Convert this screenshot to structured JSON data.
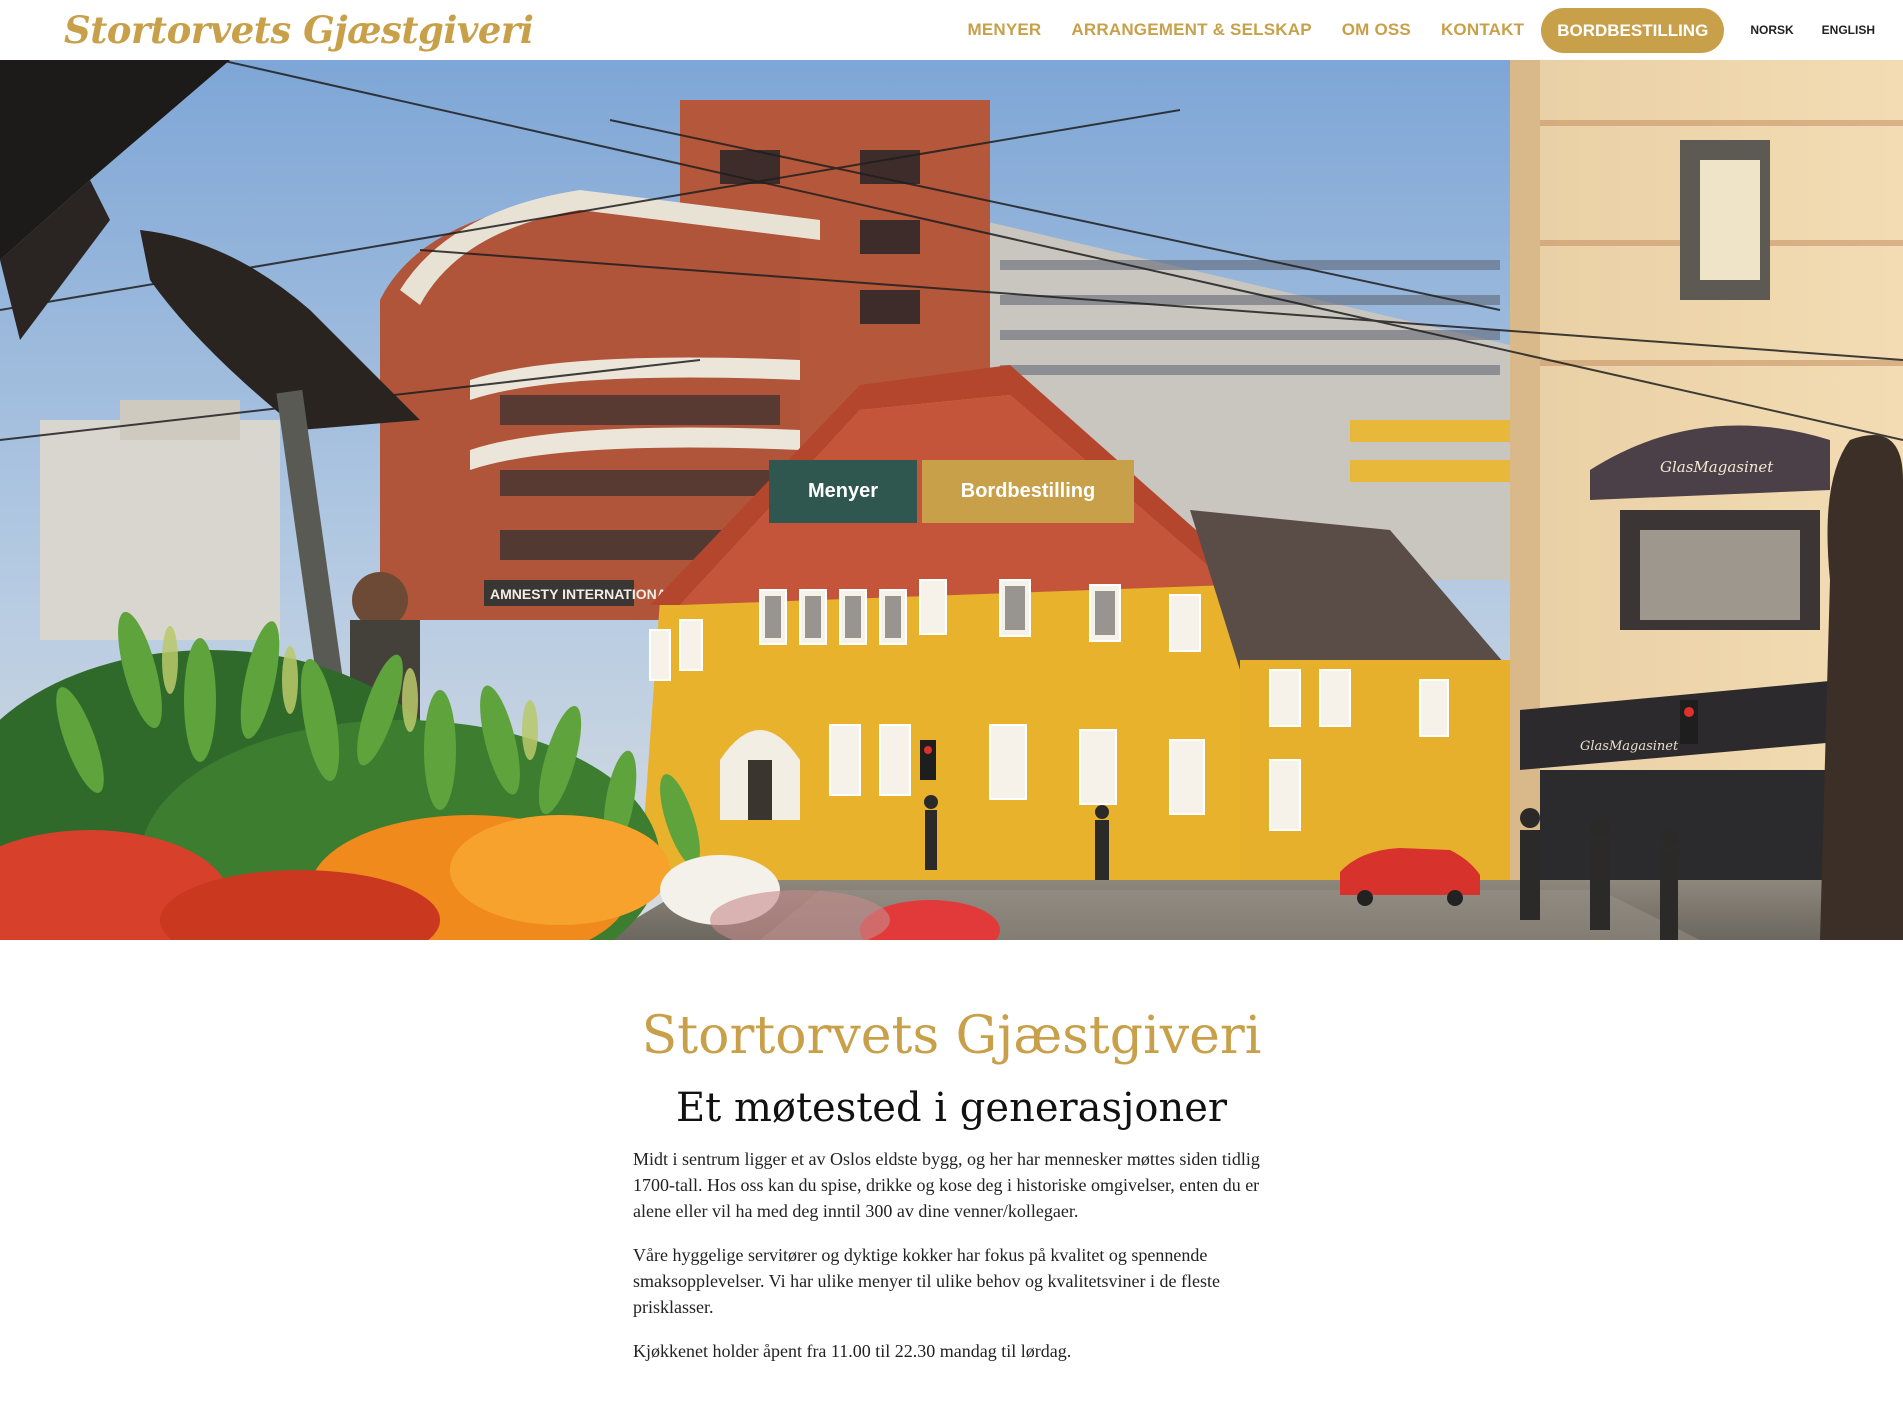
{
  "header": {
    "logo_text": "Stortorvets Gjæstgiveri",
    "nav": [
      {
        "label": "MENYER"
      },
      {
        "label": "ARRANGEMENT & SELSKAP"
      },
      {
        "label": "OM OSS"
      },
      {
        "label": "KONTAKT"
      }
    ],
    "cta_label": "BORDBESTILLING",
    "languages": [
      "NORSK",
      "ENGLISH"
    ]
  },
  "hero": {
    "buttons": {
      "menyer": "Menyer",
      "bordbestilling": "Bordbestilling"
    },
    "signs": {
      "amnesty": "AMNESTY INTERNATIONAL",
      "glasmagasinet_awning": "GlasMagasinet",
      "glasmagasinet_lower": "GlasMagasinet"
    }
  },
  "intro": {
    "title": "Stortorvets Gjæstgiveri",
    "subtitle": "Et møtested i generasjoner",
    "paragraphs": [
      "Midt i sentrum ligger et av Oslos eldste bygg, og her har mennesker møttes siden tidlig 1700-tall. Hos oss kan du spise, drikke og kose deg i historiske omgivelser, enten du er alene eller vil ha med deg inntil 300 av dine venner/kollegaer.",
      "Våre hyggelige servitører og dyktige kokker har fokus på kvalitet og spennende smaksopplevelser. Vi har ulike menyer til ulike behov og kvalitetsviner i de fleste prisklasser.",
      "Kjøkkenet holder åpent fra 11.00 til 22.30 mandag til lørdag."
    ]
  },
  "colors": {
    "gold": "#c9a04a",
    "dark_green": "#2f5750",
    "text": "#222222",
    "yellow_building": "#e9b22c"
  }
}
